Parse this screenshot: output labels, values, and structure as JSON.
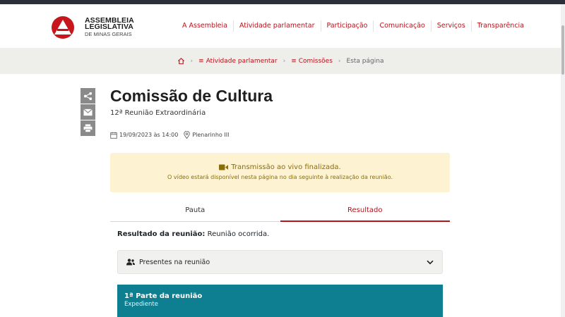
{
  "logo": {
    "line1": "ASSEMBLEIA",
    "line2": "LEGISLATIVA",
    "line3": "DE MINAS GERAIS",
    "icon": "almg-triangle-logo"
  },
  "nav": [
    {
      "label": "A Assembleia"
    },
    {
      "label": "Atividade parlamentar"
    },
    {
      "label": "Participação"
    },
    {
      "label": "Comunicação"
    },
    {
      "label": "Serviços"
    },
    {
      "label": "Transparência"
    }
  ],
  "breadcrumb": {
    "home_icon": "home-icon",
    "item1": "Atividade parlamentar",
    "item2": "Comissões",
    "current": "Esta página"
  },
  "share": {
    "icons": [
      "share-icon",
      "mail-icon",
      "print-icon"
    ]
  },
  "page": {
    "title": "Comissão de Cultura",
    "subtitle": "12ª Reunião Extraordinária",
    "datetime": "19/09/2023 às 14:00",
    "location": "Plenarinho III"
  },
  "alert": {
    "line1": "Transmissão ao vivo finalizada.",
    "line2": "O vídeo estará disponível nesta página no dia seguinte à realização da reunião.",
    "icon": "video-camera-icon"
  },
  "tabs": [
    {
      "label": "Pauta",
      "active": false
    },
    {
      "label": "Resultado",
      "active": true
    }
  ],
  "resultado": {
    "label": "Resultado da reunião:",
    "value": "Reunião ocorrida."
  },
  "accordion": {
    "label": "Presentes na reunião",
    "icon": "users-icon"
  },
  "part": {
    "title": "1ª Parte da reunião",
    "subtitle": "Expediente"
  },
  "colors": {
    "brand_red": "#b5121b",
    "alert_bg": "#fdf3d2",
    "alert_text": "#8a6d0b",
    "teal": "#0e7f90",
    "breadcrumb_bg": "#eeeeea"
  }
}
